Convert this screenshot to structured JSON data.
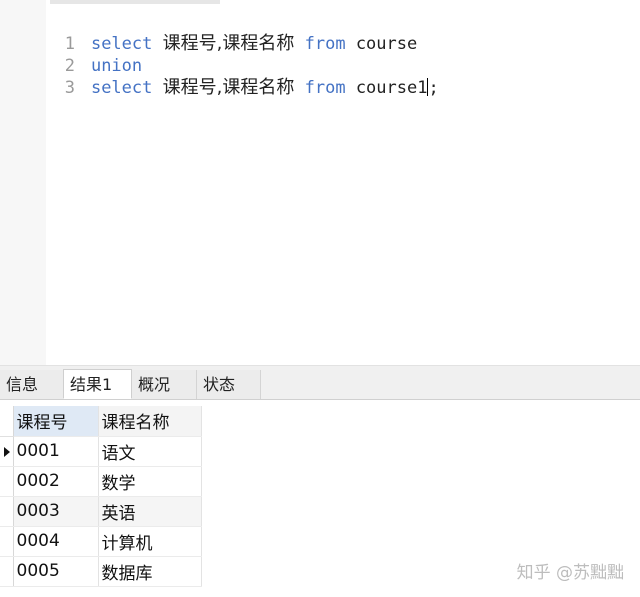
{
  "editor": {
    "lines": [
      {
        "num": "1",
        "kw1": "select",
        "cols": "课程号,课程名称",
        "kw2": "from",
        "table": "course"
      },
      {
        "num": "2",
        "kw1": "union"
      },
      {
        "num": "3",
        "kw1": "select",
        "cols": "课程号,课程名称",
        "kw2": "from",
        "table": "course1",
        "tail": ";"
      }
    ]
  },
  "tabs": [
    {
      "label": "信息"
    },
    {
      "label": "结果1"
    },
    {
      "label": "概况"
    },
    {
      "label": "状态"
    }
  ],
  "active_tab": "结果1",
  "results": {
    "headers": [
      "课程号",
      "课程名称"
    ],
    "rows": [
      [
        "0001",
        "语文"
      ],
      [
        "0002",
        "数学"
      ],
      [
        "0003",
        "英语"
      ],
      [
        "0004",
        "计算机"
      ],
      [
        "0005",
        "数据库"
      ]
    ]
  },
  "watermark": "知乎 @苏黜黜",
  "colors": {
    "keyword": "#4472c4",
    "header_selected": "#dfe9f5"
  }
}
